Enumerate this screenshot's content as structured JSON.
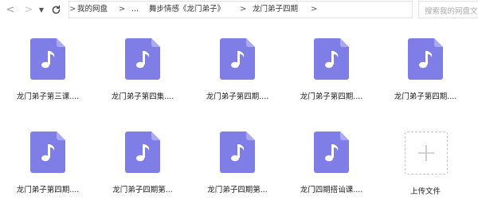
{
  "colors": {
    "accent": "#7f7ee6",
    "note": "#ffffff"
  },
  "nav": {
    "back_icon": "chevron-left-icon",
    "forward_icon": "chevron-right-icon",
    "history_icon": "caret-down-icon",
    "refresh_icon": "refresh-icon"
  },
  "breadcrumb": {
    "items": [
      "我的网盘",
      "...",
      "舞步情感《龙门弟子》",
      "龙门弟子四期"
    ],
    "separator": ">"
  },
  "search": {
    "placeholder": "搜索我的网盘文件"
  },
  "files": [
    {
      "name": "龙门弟子第三课....",
      "icon": "audio-file-icon"
    },
    {
      "name": "龙门弟子第四集....",
      "icon": "audio-file-icon"
    },
    {
      "name": "龙门弟子第四期....",
      "icon": "audio-file-icon"
    },
    {
      "name": "龙门弟子第四期....",
      "icon": "audio-file-icon"
    },
    {
      "name": "龙门弟子第四期....",
      "icon": "audio-file-icon"
    },
    {
      "name": "龙门弟子第四期....",
      "icon": "audio-file-icon"
    },
    {
      "name": "龙门弟子四期第...",
      "icon": "audio-file-icon"
    },
    {
      "name": "龙门弟子四期第...",
      "icon": "audio-file-icon"
    },
    {
      "name": "龙门四期搭讪课....",
      "icon": "audio-file-icon"
    }
  ],
  "upload": {
    "label": "上传文件",
    "icon": "plus-icon"
  }
}
